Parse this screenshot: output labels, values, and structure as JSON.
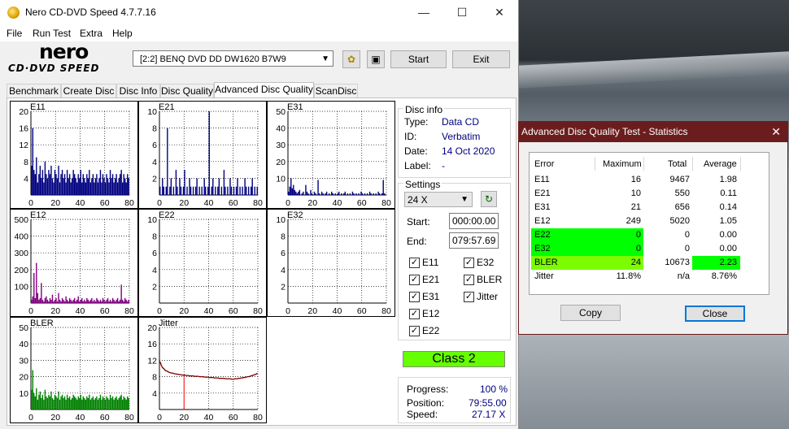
{
  "window": {
    "title": "Nero CD-DVD Speed 4.7.7.16"
  },
  "menu": [
    "File",
    "Run Test",
    "Extra",
    "Help"
  ],
  "logo": {
    "top": "nero",
    "bottom": "CD·DVD SPEED"
  },
  "toolbar": {
    "drive": "[2:2]   BENQ DVD DD DW1620 B7W9",
    "start": "Start",
    "exit": "Exit"
  },
  "tabs": [
    "Benchmark",
    "Create Disc",
    "Disc Info",
    "Disc Quality",
    "Advanced Disc Quality",
    "ScanDisc"
  ],
  "disc_info": {
    "title": "Disc info",
    "type_label": "Type:",
    "type": "Data CD",
    "id_label": "ID:",
    "id": "Verbatim",
    "date_label": "Date:",
    "date": "14 Oct 2020",
    "label_label": "Label:",
    "label": "-"
  },
  "settings": {
    "title": "Settings",
    "speed": "24 X",
    "start_label": "Start:",
    "start": "000:00.00",
    "end_label": "End:",
    "end": "079:57.69",
    "checks": [
      {
        "label": "E11",
        "checked": true
      },
      {
        "label": "E32",
        "checked": true
      },
      {
        "label": "E21",
        "checked": true
      },
      {
        "label": "BLER",
        "checked": true
      },
      {
        "label": "E31",
        "checked": true
      },
      {
        "label": "Jitter",
        "checked": true
      },
      {
        "label": "E12",
        "checked": true
      },
      {
        "label": "E22",
        "checked": true
      }
    ]
  },
  "class_label": "Class 2",
  "progress": {
    "progress_label": "Progress:",
    "progress": "100 %",
    "position_label": "Position:",
    "position": "79:55.00",
    "speed_label": "Speed:",
    "speed": "27.17 X"
  },
  "dialog": {
    "title": "Advanced Disc Quality Test - Statistics",
    "headers": [
      "Error",
      "Maximum",
      "Total",
      "Average"
    ],
    "rows": [
      {
        "name": "E11",
        "max": "16",
        "total": "9467",
        "avg": "1.98"
      },
      {
        "name": "E21",
        "max": "10",
        "total": "550",
        "avg": "0.11"
      },
      {
        "name": "E31",
        "max": "21",
        "total": "656",
        "avg": "0.14"
      },
      {
        "name": "E12",
        "max": "249",
        "total": "5020",
        "avg": "1.05"
      },
      {
        "name": "E22",
        "max": "0",
        "total": "0",
        "avg": "0.00"
      },
      {
        "name": "E32",
        "max": "0",
        "total": "0",
        "avg": "0.00"
      },
      {
        "name": "BLER",
        "max": "24",
        "total": "10673",
        "avg": "2.23"
      },
      {
        "name": "Jitter",
        "max": "11.8%",
        "total": "n/a",
        "avg": "8.76%"
      }
    ],
    "copy": "Copy",
    "close": "Close"
  },
  "colors": {
    "bar_blue": "#000080",
    "bar_purple": "#800080",
    "bar_green": "#008000",
    "jitter": "#800000",
    "marker_red": "#ff0000",
    "class_green": "#66ff00",
    "highlight_green": "#00ff00",
    "highlight_lime": "#7cfc00",
    "dialog_title": "#6b1d1d"
  },
  "chart_data": [
    {
      "type": "bar",
      "title": "E11",
      "x": [
        0,
        20,
        40,
        60,
        80
      ],
      "xlim": [
        0,
        80
      ],
      "ylim": [
        0,
        20
      ],
      "yticks": [
        4,
        8,
        12,
        16,
        20
      ],
      "grid": true,
      "color": "#000080",
      "values": [
        7,
        16,
        6,
        5,
        9,
        3,
        5,
        7,
        4,
        6,
        3,
        8,
        5,
        4,
        6,
        5,
        7,
        4,
        3,
        6,
        5,
        4,
        7,
        3,
        5,
        6,
        4,
        5,
        3,
        6,
        4,
        5,
        3,
        4,
        6,
        5,
        4,
        3,
        5,
        4,
        6,
        3,
        5,
        4,
        3,
        5,
        4,
        6,
        3,
        4,
        5,
        3,
        4,
        5,
        3,
        4,
        6,
        3,
        5,
        4,
        3,
        5,
        4,
        3,
        6,
        4,
        5,
        3,
        4,
        5,
        3,
        4,
        5,
        6,
        3,
        5,
        4,
        3,
        5,
        4
      ]
    },
    {
      "type": "bar",
      "title": "E21",
      "x": [
        0,
        20,
        40,
        60,
        80
      ],
      "xlim": [
        0,
        80
      ],
      "ylim": [
        0,
        10
      ],
      "yticks": [
        2,
        4,
        6,
        8,
        10
      ],
      "grid": true,
      "color": "#000080",
      "values": [
        1,
        0,
        2,
        1,
        0,
        1,
        8,
        0,
        1,
        2,
        0,
        1,
        0,
        3,
        1,
        0,
        2,
        1,
        0,
        1,
        3,
        0,
        1,
        0,
        2,
        1,
        0,
        1,
        0,
        1,
        2,
        0,
        1,
        0,
        1,
        0,
        2,
        1,
        0,
        1,
        10,
        0,
        1,
        2,
        0,
        1,
        0,
        1,
        2,
        0,
        1,
        0,
        3,
        1,
        0,
        1,
        0,
        2,
        1,
        0,
        1,
        0,
        1,
        2,
        0,
        1,
        0,
        1,
        0,
        2,
        1,
        0,
        1,
        0,
        1,
        2,
        0,
        1,
        0,
        1
      ]
    },
    {
      "type": "bar",
      "title": "E31",
      "x": [
        0,
        20,
        40,
        60,
        80
      ],
      "xlim": [
        0,
        80
      ],
      "ylim": [
        0,
        50
      ],
      "yticks": [
        10,
        20,
        30,
        40,
        50
      ],
      "grid": true,
      "color": "#000080",
      "values": [
        2,
        5,
        10,
        4,
        6,
        3,
        2,
        1,
        2,
        3,
        0,
        1,
        2,
        0,
        6,
        2,
        1,
        0,
        3,
        1,
        0,
        2,
        1,
        0,
        9,
        1,
        0,
        2,
        1,
        0,
        1,
        2,
        0,
        1,
        0,
        2,
        1,
        0,
        1,
        0,
        1,
        2,
        0,
        1,
        0,
        1,
        2,
        0,
        1,
        0,
        1,
        0,
        2,
        1,
        0,
        1,
        0,
        1,
        0,
        2,
        1,
        0,
        1,
        0,
        1,
        0,
        2,
        1,
        0,
        1,
        0,
        1,
        0,
        2,
        1,
        0,
        1,
        9,
        1,
        0
      ]
    },
    {
      "type": "bar",
      "title": "E12",
      "x": [
        0,
        20,
        40,
        60,
        80
      ],
      "xlim": [
        0,
        80
      ],
      "ylim": [
        0,
        500
      ],
      "yticks": [
        100,
        200,
        300,
        400,
        500
      ],
      "grid": true,
      "color": "#800080",
      "values": [
        20,
        40,
        180,
        30,
        240,
        60,
        20,
        30,
        120,
        20,
        10,
        30,
        40,
        20,
        10,
        30,
        20,
        50,
        10,
        20,
        30,
        10,
        60,
        20,
        10,
        30,
        20,
        10,
        40,
        20,
        10,
        30,
        20,
        10,
        20,
        30,
        10,
        20,
        40,
        10,
        20,
        30,
        10,
        20,
        10,
        30,
        20,
        10,
        20,
        30,
        10,
        20,
        10,
        30,
        20,
        10,
        20,
        10,
        30,
        20,
        10,
        20,
        30,
        10,
        20,
        10,
        30,
        20,
        10,
        20,
        30,
        10,
        20,
        110,
        20,
        10,
        30,
        20,
        10,
        20
      ]
    },
    {
      "type": "bar",
      "title": "E22",
      "x": [
        0,
        20,
        40,
        60,
        80
      ],
      "xlim": [
        0,
        80
      ],
      "ylim": [
        0,
        10
      ],
      "yticks": [
        2,
        4,
        6,
        8,
        10
      ],
      "grid": true,
      "color": "#800080",
      "values": []
    },
    {
      "type": "bar",
      "title": "E32",
      "x": [
        0,
        20,
        40,
        60,
        80
      ],
      "xlim": [
        0,
        80
      ],
      "ylim": [
        0,
        10
      ],
      "yticks": [
        2,
        4,
        6,
        8,
        10
      ],
      "grid": true,
      "color": "#800080",
      "values": []
    },
    {
      "type": "bar",
      "title": "BLER",
      "x": [
        0,
        20,
        40,
        60,
        80
      ],
      "xlim": [
        0,
        80
      ],
      "ylim": [
        0,
        50
      ],
      "yticks": [
        10,
        20,
        30,
        40,
        50
      ],
      "grid": true,
      "color": "#008000",
      "values": [
        12,
        24,
        10,
        8,
        13,
        6,
        9,
        11,
        7,
        9,
        6,
        12,
        8,
        7,
        9,
        8,
        11,
        7,
        6,
        9,
        8,
        7,
        11,
        6,
        8,
        9,
        7,
        8,
        6,
        9,
        7,
        8,
        6,
        7,
        9,
        8,
        7,
        6,
        8,
        7,
        9,
        6,
        8,
        7,
        6,
        8,
        7,
        9,
        6,
        7,
        8,
        6,
        7,
        8,
        6,
        7,
        9,
        6,
        8,
        7,
        6,
        8,
        7,
        6,
        9,
        7,
        8,
        6,
        7,
        8,
        6,
        7,
        8,
        9,
        6,
        8,
        7,
        6,
        8,
        7
      ]
    },
    {
      "type": "line",
      "title": "Jitter",
      "x": [
        0,
        20,
        40,
        60,
        80
      ],
      "xlim": [
        0,
        80
      ],
      "ylim": [
        0,
        20
      ],
      "yticks": [
        4,
        8,
        12,
        16,
        20
      ],
      "grid": true,
      "color": "#800000",
      "marker_x": 20,
      "values": [
        11.6,
        10.8,
        10.2,
        10.0,
        9.6,
        9.4,
        9.3,
        9.1,
        9.0,
        8.9,
        8.9,
        8.8,
        8.7,
        8.7,
        8.6,
        8.6,
        8.5,
        8.5,
        8.4,
        8.4,
        8.4,
        8.3,
        8.3,
        8.3,
        8.2,
        8.2,
        8.2,
        8.2,
        8.1,
        8.1,
        8.1,
        8.1,
        8.0,
        8.0,
        8.0,
        8.0,
        7.9,
        7.9,
        7.9,
        7.9,
        7.8,
        7.8,
        7.8,
        7.8,
        7.7,
        7.7,
        7.7,
        7.7,
        7.6,
        7.6,
        7.6,
        7.6,
        7.6,
        7.5,
        7.5,
        7.5,
        7.5,
        7.5,
        7.4,
        7.4,
        7.4,
        7.5,
        7.5,
        7.5,
        7.6,
        7.6,
        7.7,
        7.7,
        7.8,
        7.8,
        7.9,
        8.0,
        8.0,
        8.1,
        8.2,
        8.3,
        8.4,
        8.5,
        8.6,
        8.8
      ]
    }
  ]
}
